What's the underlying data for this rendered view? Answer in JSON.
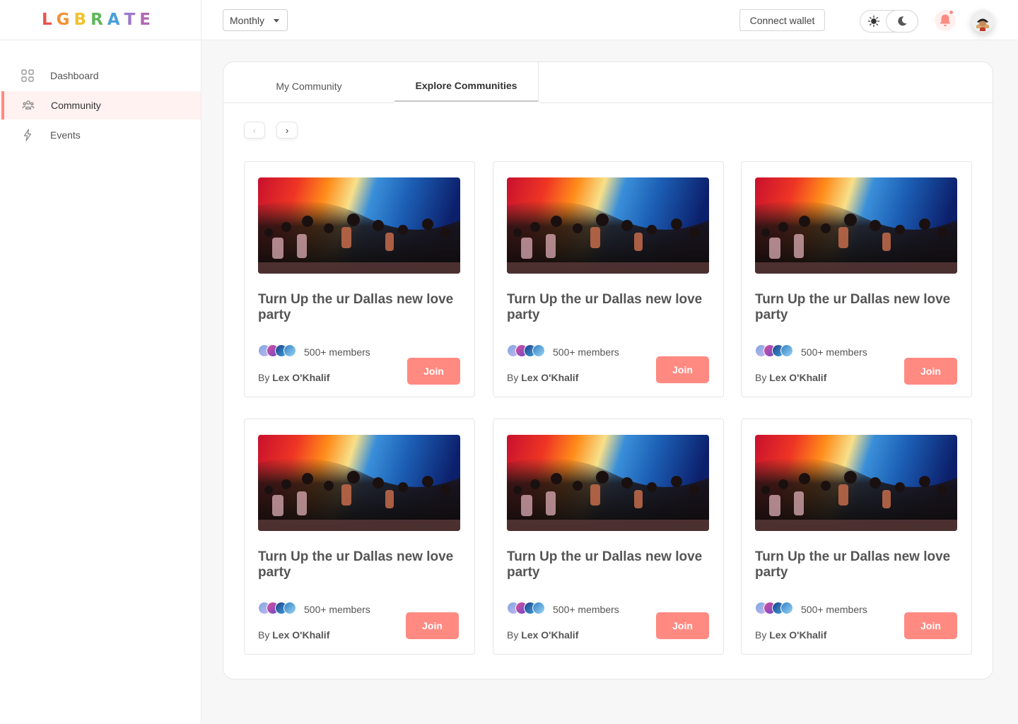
{
  "brand": {
    "letters": [
      "L",
      "G",
      "B",
      "R",
      "A",
      "T",
      "E"
    ],
    "colors": [
      "#e8524a",
      "#f09238",
      "#f0c330",
      "#5fb85a",
      "#4a9fd8",
      "#9b79c9",
      "#b06ab3"
    ]
  },
  "sidebar": {
    "items": [
      {
        "label": "Dashboard",
        "icon": "grid-icon",
        "active": false
      },
      {
        "label": "Community",
        "icon": "people-icon",
        "active": true
      },
      {
        "label": "Events",
        "icon": "lightning-icon",
        "active": false
      }
    ]
  },
  "header": {
    "period_select": "Monthly",
    "wallet_button": "Connect wallet"
  },
  "tabs": [
    {
      "label": "My Community",
      "active": false
    },
    {
      "label": "Explore Communities",
      "active": true
    }
  ],
  "pager": {
    "prev": "‹",
    "next": "›"
  },
  "cards": [
    {
      "title": "Turn Up the ur Dallas new love party",
      "members": "500+ members",
      "by_prefix": "By",
      "author": "Lex O'Khalif",
      "join": "Join"
    },
    {
      "title": "Turn Up the ur Dallas new love party",
      "members": "500+ members",
      "by_prefix": "By",
      "author": "Lex O'Khalif",
      "join": "Join"
    },
    {
      "title": "Turn Up the ur Dallas new love party",
      "members": "500+ members",
      "by_prefix": "By",
      "author": "Lex O'Khalif",
      "join": "Join"
    },
    {
      "title": "Turn Up the ur Dallas new love party",
      "members": "500+ members",
      "by_prefix": "By",
      "author": "Lex O'Khalif",
      "join": "Join"
    },
    {
      "title": "Turn Up the ur Dallas new love party",
      "members": "500+ members",
      "by_prefix": "By",
      "author": "Lex O'Khalif",
      "join": "Join"
    },
    {
      "title": "Turn Up the ur Dallas new love party",
      "members": "500+ members",
      "by_prefix": "By",
      "author": "Lex O'Khalif",
      "join": "Join"
    }
  ],
  "colors": {
    "accent": "#ff8a82",
    "accent_bg": "#fff2f1"
  }
}
